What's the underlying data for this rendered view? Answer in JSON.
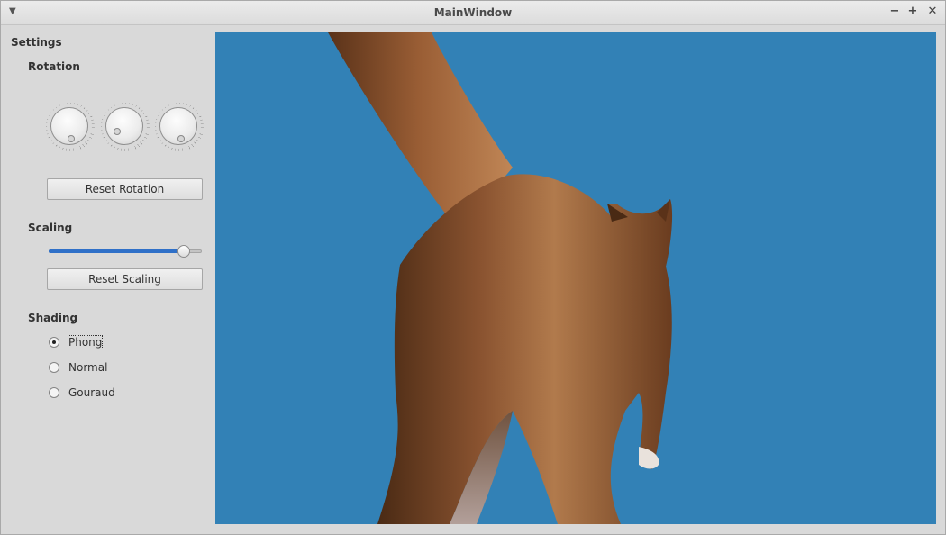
{
  "window": {
    "title": "MainWindow",
    "menu_icon": "chevron-down-icon",
    "controls": {
      "minimize": "−",
      "maximize": "+",
      "close": "✕"
    }
  },
  "settings": {
    "heading": "Settings",
    "rotation": {
      "heading": "Rotation",
      "dials": [
        "x-rotation-dial",
        "y-rotation-dial",
        "z-rotation-dial"
      ],
      "reset_label": "Reset Rotation"
    },
    "scaling": {
      "heading": "Scaling",
      "slider_fraction": 0.88,
      "reset_label": "Reset Scaling"
    },
    "shading": {
      "heading": "Shading",
      "options": [
        {
          "label": "Phong",
          "checked": true
        },
        {
          "label": "Normal",
          "checked": false
        },
        {
          "label": "Gouraud",
          "checked": false
        }
      ]
    }
  },
  "viewport": {
    "background": "#3281b6",
    "model": "cat"
  },
  "colors": {
    "accent": "#2f70c8",
    "viewport_bg": "#3281b6"
  }
}
